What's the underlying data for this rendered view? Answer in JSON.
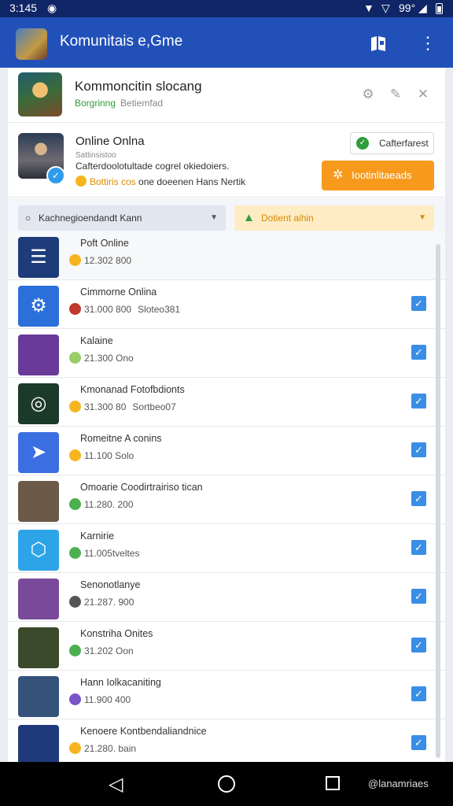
{
  "status_bar": {
    "time": "3:145",
    "battery_label": "99°"
  },
  "app_bar": {
    "title": "Komunitais e,Gme"
  },
  "header": {
    "title": "Kommoncitin slocang",
    "sub_green": "Borgrinng",
    "sub_gray": "Betiemfad"
  },
  "profile": {
    "name": "Online Onlna",
    "sub": "Sattinsistoo",
    "line1": "Cafterdoolotultade cogrel okiedoiers.",
    "line2_warn": "Bottiris cos",
    "line2_rest": "one doeenen Hans Nertik",
    "chip_label": "Cafterfarest",
    "cta_label": "Iootinlitaeads"
  },
  "filters": {
    "search_label": "Kachnegioendandt Kann",
    "alert_label": "Dotient aihin"
  },
  "list": {
    "items": [
      {
        "title": "Poft Online",
        "meta": "12.302 800",
        "extra": "",
        "icon_bg": "#1e3c7a",
        "dot": "#f6b51e",
        "checked": false,
        "glyph": "☰",
        "icon": "list-icon"
      },
      {
        "title": "Cimmorne Onlina",
        "meta": "31.000 800",
        "extra": "Sloteo381",
        "icon_bg": "#2b6fdb",
        "dot": "#c0392b",
        "checked": true,
        "glyph": "⚙",
        "icon": "cog-badge-icon"
      },
      {
        "title": "Kalaine",
        "meta": "21.300 Ono",
        "extra": "",
        "icon_bg": "#6a3a9a",
        "dot": "#9acd65",
        "checked": true,
        "glyph": "",
        "icon": "game-thumbnail-icon"
      },
      {
        "title": "Kmonanad Fotofbdionts",
        "meta": "31.300 80",
        "extra": "Sortbeo07",
        "icon_bg": "#1c3a2a",
        "dot": "#f6b51e",
        "checked": true,
        "glyph": "◎",
        "icon": "game-thumbnail-icon"
      },
      {
        "title": "Romeitne A conins",
        "meta": "11.100 Solo",
        "extra": "",
        "icon_bg": "#3b6ee0",
        "dot": "#f6b51e",
        "checked": true,
        "glyph": "➤",
        "icon": "arrow-app-icon"
      },
      {
        "title": "Omoarie Coodirtrairiso tican",
        "meta": "11.280. 200",
        "extra": "",
        "icon_bg": "#6b5a48",
        "dot": "#4cb050",
        "checked": true,
        "glyph": "",
        "icon": "game-thumbnail-icon"
      },
      {
        "title": "Karnirie",
        "meta": "11.005tveltes",
        "extra": "",
        "icon_bg": "#2ea4e8",
        "dot": "#4cb050",
        "checked": true,
        "glyph": "⬡",
        "icon": "shield-app-icon"
      },
      {
        "title": "Senonotlanye",
        "meta": "21.287. 900",
        "extra": "",
        "icon_bg": "#7a4a9a",
        "dot": "#555555",
        "checked": true,
        "glyph": "",
        "icon": "game-thumbnail-icon"
      },
      {
        "title": "Konstriha Onites",
        "meta": "31.202 Oon",
        "extra": "",
        "icon_bg": "#3a4a2a",
        "dot": "#4cb050",
        "checked": true,
        "glyph": "",
        "icon": "game-thumbnail-icon"
      },
      {
        "title": "Hann Iolkacaniting",
        "meta": "11.900 400",
        "extra": "",
        "icon_bg": "#35527a",
        "dot": "#7b55c7",
        "checked": true,
        "glyph": "",
        "icon": "game-thumbnail-icon"
      },
      {
        "title": "Kenoere Kontbendaliandnice",
        "meta": "21.280. bain",
        "extra": "",
        "icon_bg": "#1f3a7a",
        "dot": "#f6b51e",
        "checked": true,
        "glyph": "",
        "icon": "game-thumbnail-icon"
      }
    ]
  },
  "nav": {
    "watermark": "@lanamriaes"
  },
  "colors": {
    "app_bar": "#2150b8",
    "status_bar": "#0f2566",
    "cta": "#f79a1b",
    "check": "#3a8ee6",
    "success": "#2e9d3c"
  }
}
